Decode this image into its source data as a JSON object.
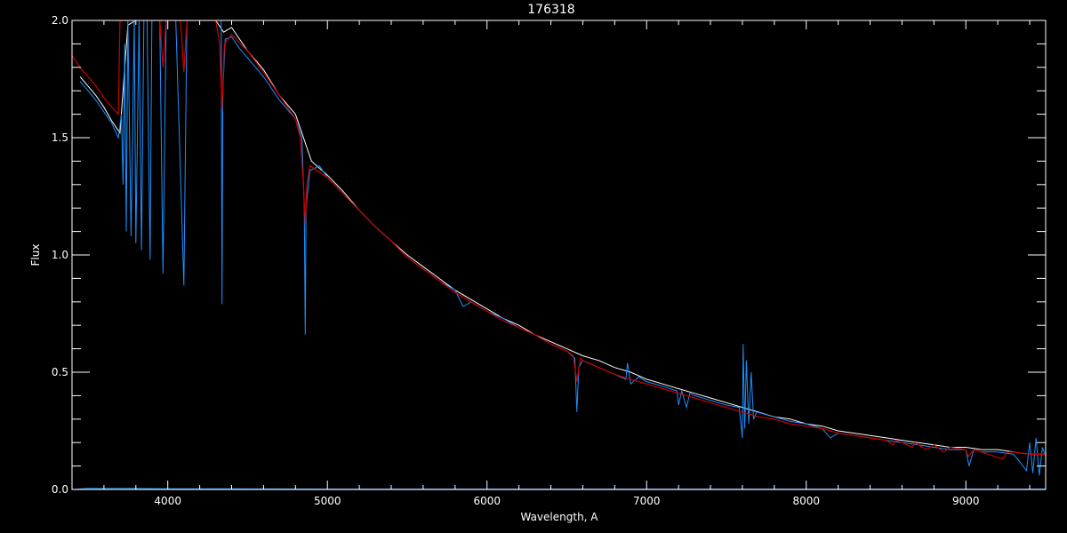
{
  "chart_data": {
    "type": "line",
    "title": "176318",
    "xlabel": "Wavelength, A",
    "ylabel": "Flux",
    "xlim": [
      3400,
      9500
    ],
    "ylim": [
      0.0,
      2.0
    ],
    "x_ticks": [
      4000,
      5000,
      6000,
      7000,
      8000,
      9000
    ],
    "x_tick_labels": [
      "4000",
      "5000",
      "6000",
      "7000",
      "8000",
      "9000"
    ],
    "y_ticks": [
      0.0,
      0.5,
      1.0,
      1.5,
      2.0
    ],
    "y_tick_labels": [
      "0.0",
      "0.5",
      "1.0",
      "1.5",
      "2.0"
    ],
    "grid": false,
    "colors": {
      "background": "#000000",
      "axes": "#ffffff",
      "observed": "#ffffff",
      "observed_alt": "#1e90ff",
      "model": "#cc0000",
      "error": "#1e90ff"
    },
    "series": [
      {
        "color_key": "observed",
        "points": [
          [
            3450,
            1.76
          ],
          [
            3500,
            1.72
          ],
          [
            3550,
            1.68
          ],
          [
            3600,
            1.63
          ],
          [
            3650,
            1.57
          ],
          [
            3700,
            1.52
          ],
          [
            3750,
            1.98
          ],
          [
            3800,
            2.0
          ],
          [
            3900,
            2.0
          ],
          [
            4000,
            2.0
          ],
          [
            4100,
            2.0
          ],
          [
            4200,
            2.0
          ],
          [
            4300,
            2.0
          ],
          [
            4350,
            1.95
          ],
          [
            4400,
            1.97
          ],
          [
            4450,
            1.92
          ],
          [
            4500,
            1.87
          ],
          [
            4600,
            1.79
          ],
          [
            4700,
            1.68
          ],
          [
            4800,
            1.6
          ],
          [
            4840,
            1.52
          ],
          [
            4900,
            1.4
          ],
          [
            5000,
            1.34
          ],
          [
            5100,
            1.27
          ],
          [
            5200,
            1.19
          ],
          [
            5300,
            1.12
          ],
          [
            5400,
            1.06
          ],
          [
            5500,
            1.0
          ],
          [
            5600,
            0.95
          ],
          [
            5700,
            0.9
          ],
          [
            5800,
            0.85
          ],
          [
            5900,
            0.81
          ],
          [
            6000,
            0.77
          ],
          [
            6100,
            0.73
          ],
          [
            6200,
            0.7
          ],
          [
            6300,
            0.66
          ],
          [
            6400,
            0.63
          ],
          [
            6500,
            0.6
          ],
          [
            6600,
            0.57
          ],
          [
            6700,
            0.55
          ],
          [
            6800,
            0.52
          ],
          [
            6900,
            0.5
          ],
          [
            7000,
            0.47
          ],
          [
            7100,
            0.45
          ],
          [
            7200,
            0.43
          ],
          [
            7300,
            0.41
          ],
          [
            7400,
            0.39
          ],
          [
            7500,
            0.37
          ],
          [
            7600,
            0.35
          ],
          [
            7700,
            0.33
          ],
          [
            7800,
            0.31
          ],
          [
            7900,
            0.3
          ],
          [
            8000,
            0.28
          ],
          [
            8100,
            0.27
          ],
          [
            8200,
            0.25
          ],
          [
            8300,
            0.24
          ],
          [
            8400,
            0.23
          ],
          [
            8500,
            0.22
          ],
          [
            8600,
            0.21
          ],
          [
            8700,
            0.2
          ],
          [
            8800,
            0.19
          ],
          [
            8900,
            0.18
          ],
          [
            9000,
            0.18
          ],
          [
            9100,
            0.17
          ],
          [
            9200,
            0.17
          ],
          [
            9300,
            0.16
          ],
          [
            9400,
            0.15
          ],
          [
            9500,
            0.15
          ]
        ]
      },
      {
        "color_key": "observed_alt",
        "points": [
          [
            3450,
            1.74
          ],
          [
            3500,
            1.7
          ],
          [
            3550,
            1.66
          ],
          [
            3600,
            1.61
          ],
          [
            3650,
            1.56
          ],
          [
            3690,
            1.5
          ],
          [
            3710,
            1.6
          ],
          [
            3720,
            1.3
          ],
          [
            3730,
            1.9
          ],
          [
            3740,
            1.1
          ],
          [
            3750,
            2.0
          ],
          [
            3770,
            1.08
          ],
          [
            3790,
            2.0
          ],
          [
            3800,
            1.05
          ],
          [
            3820,
            2.0
          ],
          [
            3835,
            1.02
          ],
          [
            3850,
            2.0
          ],
          [
            3870,
            2.0
          ],
          [
            3889,
            0.98
          ],
          [
            3900,
            2.0
          ],
          [
            3950,
            2.0
          ],
          [
            3970,
            0.92
          ],
          [
            3990,
            2.0
          ],
          [
            4050,
            2.0
          ],
          [
            4101,
            0.87
          ],
          [
            4120,
            2.0
          ],
          [
            4200,
            2.0
          ],
          [
            4300,
            2.0
          ],
          [
            4335,
            2.0
          ],
          [
            4340,
            0.79
          ],
          [
            4345,
            1.7
          ],
          [
            4360,
            1.92
          ],
          [
            4400,
            1.93
          ],
          [
            4450,
            1.88
          ],
          [
            4500,
            1.84
          ],
          [
            4600,
            1.76
          ],
          [
            4700,
            1.66
          ],
          [
            4800,
            1.58
          ],
          [
            4840,
            1.5
          ],
          [
            4855,
            1.2
          ],
          [
            4861,
            0.66
          ],
          [
            4866,
            1.2
          ],
          [
            4890,
            1.36
          ],
          [
            4950,
            1.38
          ],
          [
            5000,
            1.33
          ],
          [
            5100,
            1.26
          ],
          [
            5200,
            1.19
          ],
          [
            5300,
            1.12
          ],
          [
            5400,
            1.06
          ],
          [
            5500,
            0.99
          ],
          [
            5600,
            0.94
          ],
          [
            5700,
            0.89
          ],
          [
            5800,
            0.85
          ],
          [
            5850,
            0.78
          ],
          [
            5900,
            0.8
          ],
          [
            6000,
            0.76
          ],
          [
            6100,
            0.73
          ],
          [
            6200,
            0.69
          ],
          [
            6300,
            0.66
          ],
          [
            6400,
            0.62
          ],
          [
            6500,
            0.59
          ],
          [
            6550,
            0.56
          ],
          [
            6563,
            0.33
          ],
          [
            6575,
            0.52
          ],
          [
            6600,
            0.55
          ],
          [
            6700,
            0.52
          ],
          [
            6800,
            0.49
          ],
          [
            6870,
            0.47
          ],
          [
            6880,
            0.54
          ],
          [
            6900,
            0.45
          ],
          [
            6950,
            0.48
          ],
          [
            7000,
            0.46
          ],
          [
            7100,
            0.44
          ],
          [
            7190,
            0.42
          ],
          [
            7200,
            0.36
          ],
          [
            7220,
            0.42
          ],
          [
            7250,
            0.35
          ],
          [
            7270,
            0.41
          ],
          [
            7300,
            0.4
          ],
          [
            7400,
            0.38
          ],
          [
            7500,
            0.36
          ],
          [
            7580,
            0.35
          ],
          [
            7600,
            0.22
          ],
          [
            7605,
            0.62
          ],
          [
            7615,
            0.26
          ],
          [
            7625,
            0.55
          ],
          [
            7640,
            0.28
          ],
          [
            7655,
            0.5
          ],
          [
            7670,
            0.3
          ],
          [
            7690,
            0.33
          ],
          [
            7800,
            0.31
          ],
          [
            7900,
            0.29
          ],
          [
            8000,
            0.28
          ],
          [
            8100,
            0.26
          ],
          [
            8150,
            0.22
          ],
          [
            8200,
            0.24
          ],
          [
            8300,
            0.23
          ],
          [
            8400,
            0.22
          ],
          [
            8500,
            0.21
          ],
          [
            8600,
            0.2
          ],
          [
            8700,
            0.19
          ],
          [
            8800,
            0.18
          ],
          [
            8900,
            0.17
          ],
          [
            9000,
            0.17
          ],
          [
            9020,
            0.1
          ],
          [
            9050,
            0.17
          ],
          [
            9100,
            0.16
          ],
          [
            9200,
            0.16
          ],
          [
            9300,
            0.15
          ],
          [
            9380,
            0.08
          ],
          [
            9400,
            0.2
          ],
          [
            9420,
            0.07
          ],
          [
            9440,
            0.22
          ],
          [
            9460,
            0.06
          ],
          [
            9480,
            0.18
          ],
          [
            9500,
            0.14
          ]
        ]
      },
      {
        "color_key": "model",
        "points": [
          [
            3400,
            1.85
          ],
          [
            3450,
            1.8
          ],
          [
            3500,
            1.76
          ],
          [
            3550,
            1.72
          ],
          [
            3600,
            1.67
          ],
          [
            3650,
            1.63
          ],
          [
            3690,
            1.6
          ],
          [
            3700,
            2.0
          ],
          [
            3800,
            2.0
          ],
          [
            3900,
            2.0
          ],
          [
            3950,
            2.0
          ],
          [
            3970,
            1.8
          ],
          [
            3990,
            2.0
          ],
          [
            4080,
            2.0
          ],
          [
            4101,
            1.78
          ],
          [
            4120,
            2.0
          ],
          [
            4300,
            2.0
          ],
          [
            4325,
            1.9
          ],
          [
            4340,
            1.62
          ],
          [
            4355,
            1.9
          ],
          [
            4400,
            1.94
          ],
          [
            4500,
            1.87
          ],
          [
            4600,
            1.78
          ],
          [
            4700,
            1.68
          ],
          [
            4800,
            1.58
          ],
          [
            4830,
            1.5
          ],
          [
            4850,
            1.3
          ],
          [
            4861,
            1.13
          ],
          [
            4872,
            1.3
          ],
          [
            4890,
            1.38
          ],
          [
            5000,
            1.33
          ],
          [
            5100,
            1.26
          ],
          [
            5200,
            1.19
          ],
          [
            5300,
            1.12
          ],
          [
            5400,
            1.06
          ],
          [
            5500,
            0.99
          ],
          [
            5600,
            0.94
          ],
          [
            5700,
            0.89
          ],
          [
            5800,
            0.84
          ],
          [
            5900,
            0.8
          ],
          [
            6000,
            0.76
          ],
          [
            6100,
            0.72
          ],
          [
            6200,
            0.69
          ],
          [
            6300,
            0.66
          ],
          [
            6400,
            0.62
          ],
          [
            6500,
            0.59
          ],
          [
            6540,
            0.57
          ],
          [
            6563,
            0.46
          ],
          [
            6585,
            0.56
          ],
          [
            6600,
            0.55
          ],
          [
            6700,
            0.52
          ],
          [
            6800,
            0.49
          ],
          [
            6900,
            0.47
          ],
          [
            7000,
            0.45
          ],
          [
            7100,
            0.43
          ],
          [
            7200,
            0.41
          ],
          [
            7300,
            0.39
          ],
          [
            7400,
            0.37
          ],
          [
            7500,
            0.35
          ],
          [
            7600,
            0.33
          ],
          [
            7700,
            0.31
          ],
          [
            7800,
            0.3
          ],
          [
            7900,
            0.28
          ],
          [
            8000,
            0.27
          ],
          [
            8100,
            0.26
          ],
          [
            8200,
            0.24
          ],
          [
            8300,
            0.23
          ],
          [
            8400,
            0.22
          ],
          [
            8500,
            0.21
          ],
          [
            8545,
            0.19
          ],
          [
            8560,
            0.21
          ],
          [
            8600,
            0.2
          ],
          [
            8665,
            0.18
          ],
          [
            8680,
            0.2
          ],
          [
            8750,
            0.17
          ],
          [
            8800,
            0.19
          ],
          [
            8862,
            0.16
          ],
          [
            8900,
            0.18
          ],
          [
            9000,
            0.17
          ],
          [
            9015,
            0.14
          ],
          [
            9050,
            0.17
          ],
          [
            9229,
            0.13
          ],
          [
            9260,
            0.16
          ],
          [
            9300,
            0.16
          ],
          [
            9400,
            0.15
          ],
          [
            9500,
            0.15
          ]
        ]
      },
      {
        "color_key": "error",
        "points": [
          [
            3400,
            0.0
          ],
          [
            3500,
            0.005
          ],
          [
            3600,
            0.004
          ],
          [
            3700,
            0.005
          ],
          [
            3800,
            0.004
          ],
          [
            4000,
            0.003
          ],
          [
            5000,
            0.002
          ],
          [
            6000,
            0.002
          ],
          [
            7000,
            0.002
          ],
          [
            8000,
            0.002
          ],
          [
            9000,
            0.002
          ],
          [
            9500,
            0.002
          ]
        ]
      }
    ]
  }
}
